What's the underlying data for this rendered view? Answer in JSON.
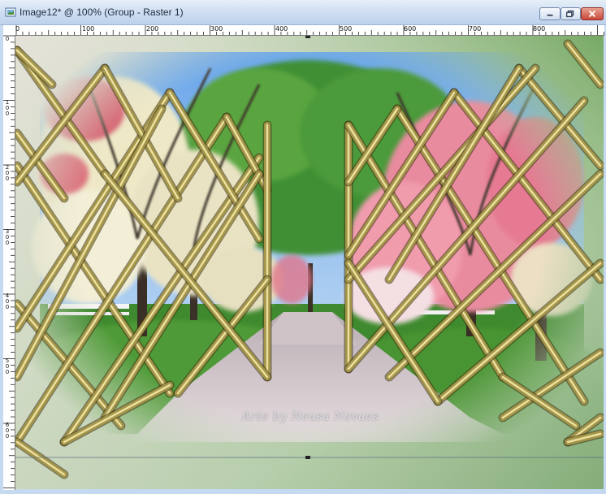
{
  "window": {
    "title": "Image12* @ 100% (Group - Raster 1)",
    "buttons": {
      "minimize": "minimize",
      "maximize": "maximize",
      "close": "close"
    }
  },
  "ruler": {
    "top_labels": [
      "0",
      "100",
      "200",
      "300",
      "400",
      "500",
      "600",
      "700",
      "800"
    ],
    "left_labels": [
      "0",
      "100",
      "200",
      "300",
      "400",
      "500",
      "600"
    ]
  },
  "canvas": {
    "watermark": "Arte by Neusa Novaes",
    "icons": [
      "lattice-fence",
      "tree",
      "road"
    ]
  },
  "colors": {
    "frame_green": "#7fae72",
    "lattice_gold": "#a3944a",
    "sky": "#7fb2e8",
    "blossom_pink": "#e98b9f",
    "road": "#c8bcc2",
    "grass": "#3f8a2e"
  }
}
